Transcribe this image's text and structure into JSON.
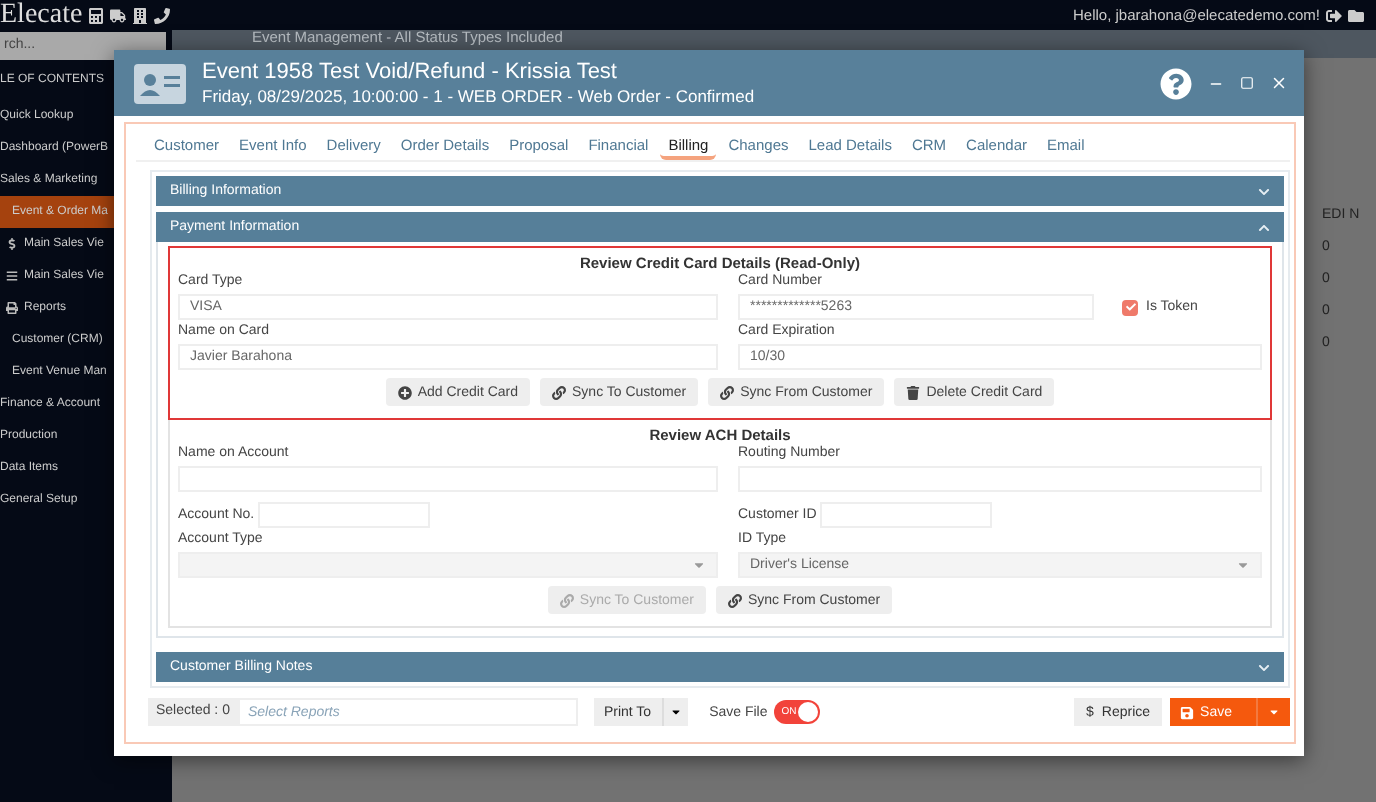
{
  "app": {
    "logo": "Elecate",
    "greeting": "Hello, jbarahona@elecatedemo.com!"
  },
  "sidebar": {
    "search_placeholder": "rch...",
    "heading": "LE OF CONTENTS",
    "items": [
      {
        "label": "Quick Lookup",
        "kind": "top",
        "selected": false
      },
      {
        "label": "Dashboard (PowerB",
        "kind": "top",
        "selected": false
      },
      {
        "label": "Sales & Marketing",
        "kind": "top",
        "selected": false
      },
      {
        "label": "Event & Order Ma",
        "kind": "sub",
        "selected": true
      },
      {
        "label": "Main Sales Vie",
        "kind": "dollar",
        "selected": false
      },
      {
        "label": "Main Sales Vie",
        "kind": "list",
        "selected": false
      },
      {
        "label": "Reports",
        "kind": "printer",
        "selected": false
      },
      {
        "label": "Customer (CRM)",
        "kind": "sub",
        "selected": false
      },
      {
        "label": "Event Venue Man",
        "kind": "sub",
        "selected": false
      },
      {
        "label": "Finance & Account",
        "kind": "top",
        "selected": false
      },
      {
        "label": "Production",
        "kind": "top",
        "selected": false
      },
      {
        "label": "Data Items",
        "kind": "top",
        "selected": false
      },
      {
        "label": "General Setup",
        "kind": "top",
        "selected": false
      }
    ]
  },
  "background_page": {
    "title": "Event Management - All Status Types Included",
    "column_header": "EDI N",
    "column_values": [
      "0",
      "0",
      "0",
      "0"
    ]
  },
  "modal": {
    "title": "Event 1958 Test Void/Refund - Krissia Test",
    "subtitle": "Friday, 08/29/2025, 10:00:00 - 1 - WEB ORDER - Web Order - Confirmed",
    "tabs": [
      {
        "label": "Customer",
        "selected": false
      },
      {
        "label": "Event Info",
        "selected": false
      },
      {
        "label": "Delivery",
        "selected": false
      },
      {
        "label": "Order Details",
        "selected": false
      },
      {
        "label": "Proposal",
        "selected": false
      },
      {
        "label": "Financial",
        "selected": false
      },
      {
        "label": "Billing",
        "selected": true
      },
      {
        "label": "Changes",
        "selected": false
      },
      {
        "label": "Lead Details",
        "selected": false
      },
      {
        "label": "CRM",
        "selected": false
      },
      {
        "label": "Calendar",
        "selected": false
      },
      {
        "label": "Email",
        "selected": false
      }
    ],
    "billing_section": {
      "title": "Billing Information",
      "expanded": false
    },
    "payment_section": {
      "title": "Payment Information",
      "expanded": true
    },
    "credit_card": {
      "title": "Review Credit Card Details (Read-Only)",
      "card_type": {
        "label": "Card Type",
        "value": "VISA"
      },
      "card_number": {
        "label": "Card Number",
        "value": "*************5263"
      },
      "is_token": {
        "label": "Is Token",
        "checked": true
      },
      "name_on_card": {
        "label": "Name on Card",
        "value": "Javier Barahona"
      },
      "card_expiration": {
        "label": "Card Expiration",
        "value": "10/30"
      },
      "buttons": [
        {
          "label": "Add Credit Card",
          "kind": "add",
          "disabled": false
        },
        {
          "label": "Sync To Customer",
          "kind": "sync",
          "disabled": false
        },
        {
          "label": "Sync From Customer",
          "kind": "sync",
          "disabled": false
        },
        {
          "label": "Delete Credit Card",
          "kind": "delete",
          "disabled": false
        }
      ]
    },
    "ach": {
      "title": "Review ACH Details",
      "name_on_account": {
        "label": "Name on Account"
      },
      "routing_number": {
        "label": "Routing Number"
      },
      "account_no": {
        "label": "Account No."
      },
      "customer_id": {
        "label": "Customer ID"
      },
      "account_type": {
        "label": "Account Type"
      },
      "id_type": {
        "label": "ID Type",
        "value": "Driver's License"
      },
      "buttons": [
        {
          "label": "Sync To Customer",
          "kind": "sync",
          "disabled": true
        },
        {
          "label": "Sync From Customer",
          "kind": "sync",
          "disabled": false
        }
      ]
    },
    "notes_section": {
      "title": "Customer Billing Notes",
      "expanded": false
    },
    "footer": {
      "selected": "Selected : 0",
      "reports_placeholder": "Select Reports",
      "print_button": "Print To",
      "save_file": {
        "label": "Save File",
        "on": true,
        "text": "ON"
      },
      "reprice": {
        "icon": "$",
        "label": "Reprice"
      },
      "save_button": "Save"
    }
  }
}
